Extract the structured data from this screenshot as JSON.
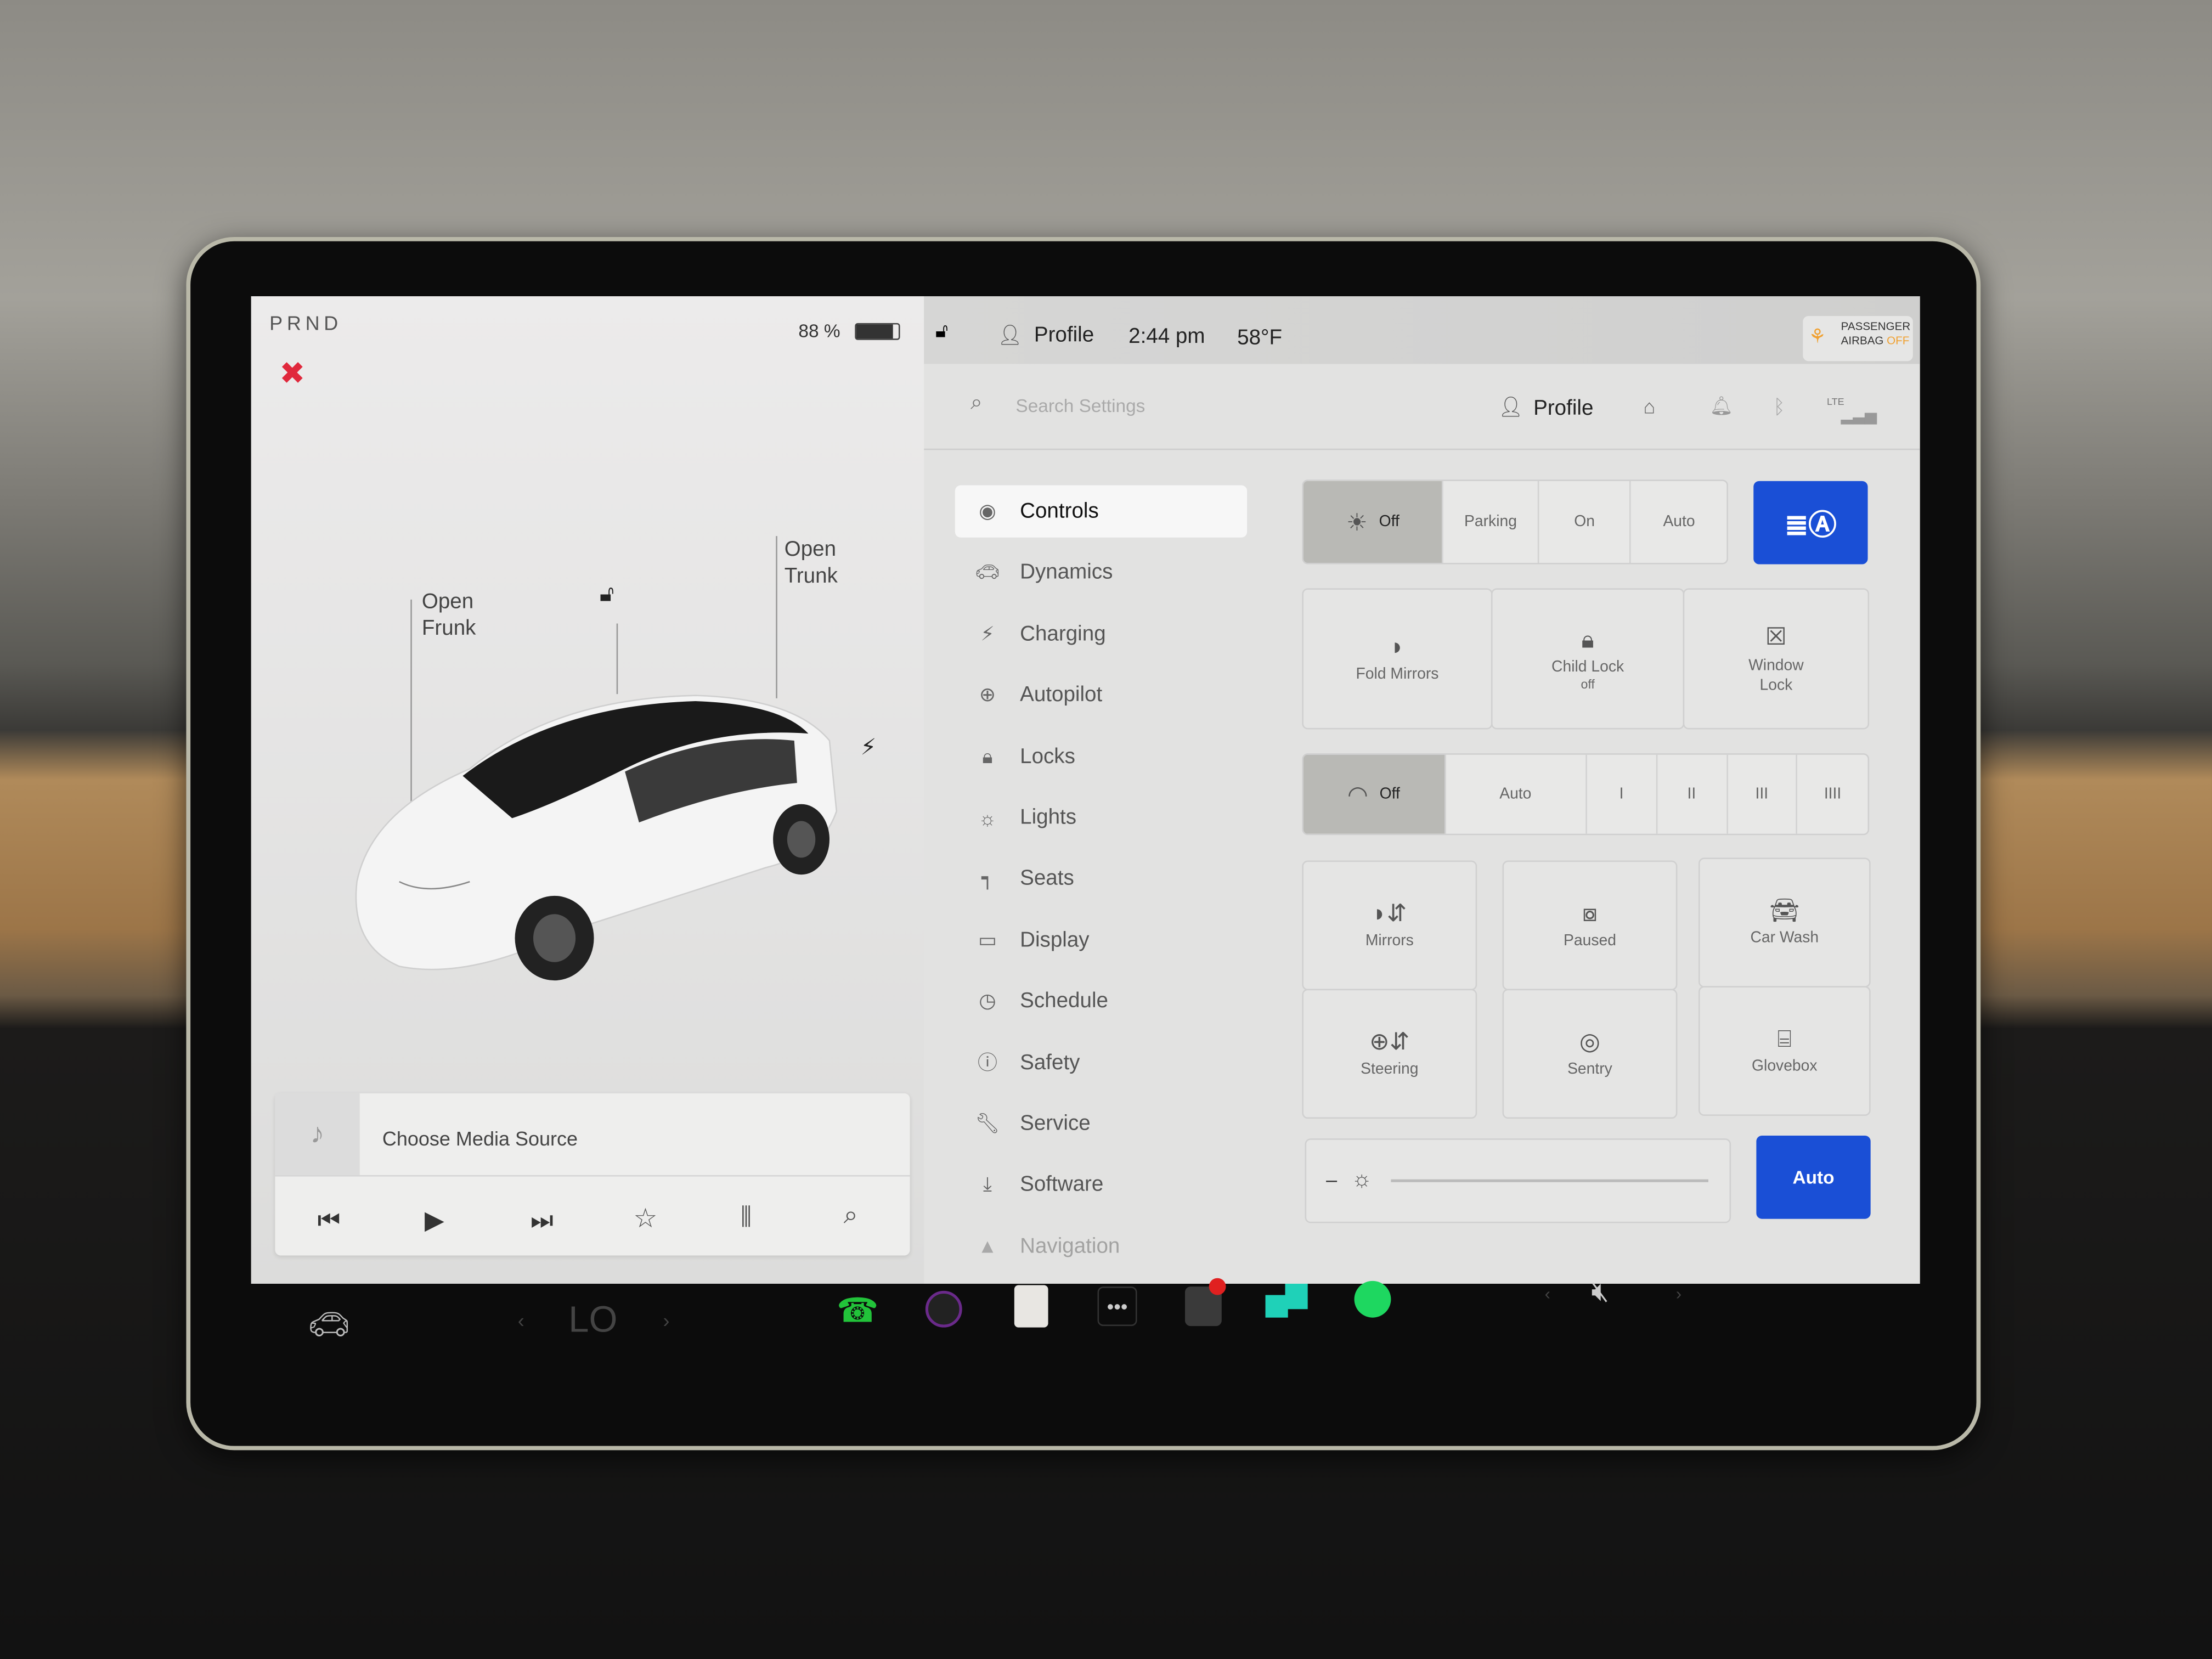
{
  "status": {
    "gear": "PRND",
    "battery_percent": "88 %",
    "battery_level": 0.88,
    "profile": "Profile",
    "time": "2:44 pm",
    "temperature": "58°F",
    "airbag_line1": "PASSENGER",
    "airbag_line2": "AIRBAG",
    "airbag_state": "OFF"
  },
  "car": {
    "frunk": "Open\nFrunk",
    "frunk_l1": "Open",
    "frunk_l2": "Frunk",
    "trunk_l1": "Open",
    "trunk_l2": "Trunk"
  },
  "media": {
    "source": "Choose Media Source"
  },
  "settings": {
    "search_placeholder": "Search Settings",
    "profile": "Profile",
    "lte": "LTE"
  },
  "menu": [
    {
      "label": "Controls",
      "icon": "toggle-icon"
    },
    {
      "label": "Dynamics",
      "icon": "car-icon"
    },
    {
      "label": "Charging",
      "icon": "bolt-icon"
    },
    {
      "label": "Autopilot",
      "icon": "steering-wheel-icon"
    },
    {
      "label": "Locks",
      "icon": "lock-icon"
    },
    {
      "label": "Lights",
      "icon": "light-icon"
    },
    {
      "label": "Seats",
      "icon": "seat-icon"
    },
    {
      "label": "Display",
      "icon": "display-icon"
    },
    {
      "label": "Schedule",
      "icon": "clock-icon"
    },
    {
      "label": "Safety",
      "icon": "alert-icon"
    },
    {
      "label": "Service",
      "icon": "wrench-icon"
    },
    {
      "label": "Software",
      "icon": "download-icon"
    },
    {
      "label": "Navigation",
      "icon": "navigation-icon"
    }
  ],
  "lights": {
    "options": [
      "Off",
      "Parking",
      "On",
      "Auto"
    ],
    "selected": "Off"
  },
  "tiles1": [
    {
      "label": "Fold Mirrors",
      "sub": ""
    },
    {
      "label": "Child Lock",
      "sub": "off"
    },
    {
      "label": "Window\nLock",
      "l1": "Window",
      "l2": "Lock"
    }
  ],
  "wipers": {
    "options": [
      "Off",
      "Auto",
      "I",
      "II",
      "III",
      "IIII"
    ],
    "selected": "Off"
  },
  "tiles2": [
    {
      "label": "Mirrors"
    },
    {
      "label": "Paused"
    },
    {
      "label": "Car Wash"
    },
    {
      "label": "Steering"
    },
    {
      "label": "Sentry"
    },
    {
      "label": "Glovebox"
    }
  ],
  "brightness": {
    "minus": "–",
    "auto": "Auto",
    "level": 0.0
  },
  "dock": {
    "temp": "LO"
  },
  "colors": {
    "accent": "#1a4fd6",
    "spotify": "#1ed760",
    "phone": "#22c33a",
    "seatbelt": "#e0283c",
    "airbag": "#f0a030"
  }
}
